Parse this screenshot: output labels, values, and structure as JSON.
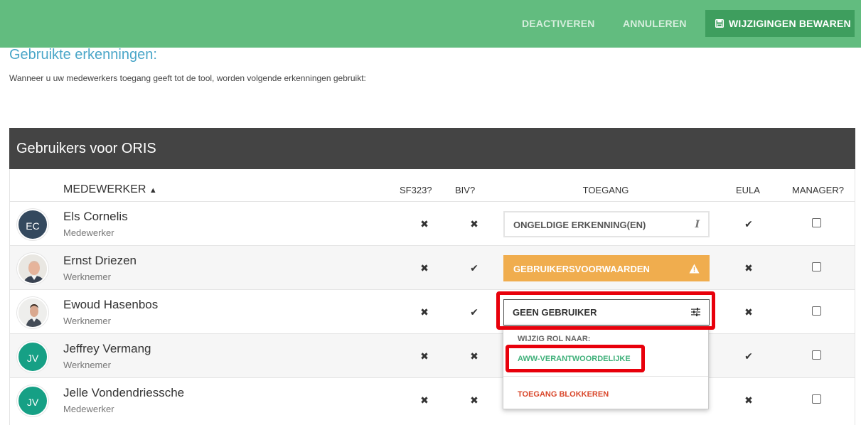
{
  "toolbar": {
    "deactivate_label": "DEACTIVEREN",
    "cancel_label": "ANNULEREN",
    "save_label": "WIJZIGINGEN BEWAREN"
  },
  "section": {
    "title": "Gebruikte erkenningen:",
    "description": "Wanneer u uw medewerkers toegang geeft tot de tool, worden volgende erkenningen gebruikt:"
  },
  "panel": {
    "title": "Gebruikers voor ORIS"
  },
  "columns": {
    "employee": "MEDEWERKER",
    "sf323": "SF323?",
    "biv": "BIV?",
    "access": "TOEGANG",
    "eula": "EULA",
    "manager": "MANAGER?"
  },
  "rows": [
    {
      "initials": "EC",
      "name": "Els Cornelis",
      "role": "Medewerker",
      "sf323": "✖",
      "biv": "✖",
      "access": "ONGELDIGE ERKENNING(EN)",
      "access_icon": "info-icon",
      "eula": "✔",
      "avatar_color": "#34495e"
    },
    {
      "initials": "",
      "name": "Ernst Driezen",
      "role": "Werknemer",
      "sf323": "✖",
      "biv": "✔",
      "access": "GEBRUIKERSVOORWAARDEN",
      "access_icon": "warning-icon",
      "eula": "✖",
      "avatar_color": "photo"
    },
    {
      "initials": "",
      "name": "Ewoud Hasenbos",
      "role": "Werknemer",
      "sf323": "✖",
      "biv": "✔",
      "access": "GEEN GEBRUIKER",
      "access_icon": "sliders-icon",
      "eula": "✖",
      "avatar_color": "photo"
    },
    {
      "initials": "JV",
      "name": "Jeffrey Vermang",
      "role": "Werknemer",
      "sf323": "✖",
      "biv": "✖",
      "access": "",
      "eula": "✔",
      "avatar_color": "#16a085"
    },
    {
      "initials": "JV",
      "name": "Jelle Vondendriessche",
      "role": "Medewerker",
      "sf323": "✖",
      "biv": "✖",
      "access": "",
      "eula": "✖",
      "avatar_color": "#16a085"
    }
  ],
  "dropdown": {
    "heading": "WIJZIG ROL NAAR:",
    "option_role": "AWW-VERANTWOORDELIJKE",
    "option_block": "TOEGANG BLOKKEREN"
  },
  "colors": {
    "topbar": "#62bc7f",
    "save_button": "#3e9e5e",
    "panel_header": "#444444",
    "warning": "#f0ad4e",
    "highlight": "#e8000b",
    "title_blue": "#4aa6c8"
  }
}
